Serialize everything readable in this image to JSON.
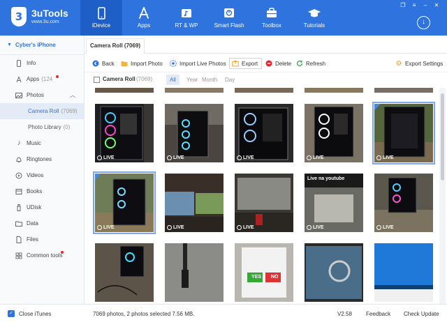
{
  "app": {
    "name": "3uTools",
    "url": "www.3u.com",
    "logo_mark": "3"
  },
  "nav": [
    {
      "label": "iDevice",
      "icon": "phone-icon"
    },
    {
      "label": "Apps",
      "icon": "app-store-icon"
    },
    {
      "label": "RT & WP",
      "icon": "ringtone-wallpaper-icon"
    },
    {
      "label": "Smart Flash",
      "icon": "flash-icon"
    },
    {
      "label": "Toolbox",
      "icon": "toolbox-icon"
    },
    {
      "label": "Tutorials",
      "icon": "graduation-cap-icon"
    }
  ],
  "sidebar": {
    "device": "Cyber's iPhone",
    "items": [
      {
        "label": "Info",
        "count": ""
      },
      {
        "label": "Apps",
        "count": "(124"
      },
      {
        "label": "Photos",
        "count": ""
      },
      {
        "label": "Camera Roll",
        "count": "(7069)"
      },
      {
        "label": "Photo Library",
        "count": "(0)"
      },
      {
        "label": "Music",
        "count": ""
      },
      {
        "label": "Ringtones",
        "count": ""
      },
      {
        "label": "Videos",
        "count": ""
      },
      {
        "label": "Books",
        "count": ""
      },
      {
        "label": "UDisk",
        "count": ""
      },
      {
        "label": "Data",
        "count": ""
      },
      {
        "label": "Files",
        "count": ""
      },
      {
        "label": "Common tools",
        "count": ""
      }
    ]
  },
  "tab": {
    "label": "Camera Roll (7069)"
  },
  "toolbar": {
    "back": "Back",
    "import_photo": "Import Photo",
    "import_live": "Import Live Photos",
    "export": "Export",
    "delete": "Delete",
    "refresh": "Refresh",
    "export_settings": "Export Settings"
  },
  "filter": {
    "label": "Camera Roll",
    "count": "(7069)",
    "tabs": [
      "All",
      "Year",
      "Month",
      "Day"
    ],
    "active": "All"
  },
  "photos": [
    {
      "live": "LIVE",
      "selected": false
    },
    {
      "live": "LIVE",
      "selected": false
    },
    {
      "live": "LIVE",
      "selected": false
    },
    {
      "live": "LIVE",
      "selected": false
    },
    {
      "live": "LIVE",
      "selected": true
    },
    {
      "live": "LIVE",
      "selected": true
    },
    {
      "live": "LIVE",
      "selected": false
    },
    {
      "live": "LIVE",
      "selected": false
    },
    {
      "live": "LIVE",
      "selected": false
    },
    {
      "live": "LIVE",
      "selected": false
    },
    {
      "live": "",
      "selected": false
    },
    {
      "live": "",
      "selected": false
    },
    {
      "live": "",
      "selected": false
    },
    {
      "live": "",
      "selected": false
    },
    {
      "live": "",
      "selected": false
    }
  ],
  "photo_texts": {
    "youtube": "Live na youtube",
    "yes": "YES",
    "no": "NO"
  },
  "status": {
    "close_itunes": "Close iTunes",
    "summary": "7069 photos, 2 photos selected 7.56 MB.",
    "version": "V2.58",
    "feedback": "Feedback",
    "check_update": "Check Update"
  },
  "colors": {
    "brand": "#2f74de",
    "nav_active": "#1d5fc7",
    "badge_red": "#e8262a",
    "selection": "#7da7e8"
  }
}
